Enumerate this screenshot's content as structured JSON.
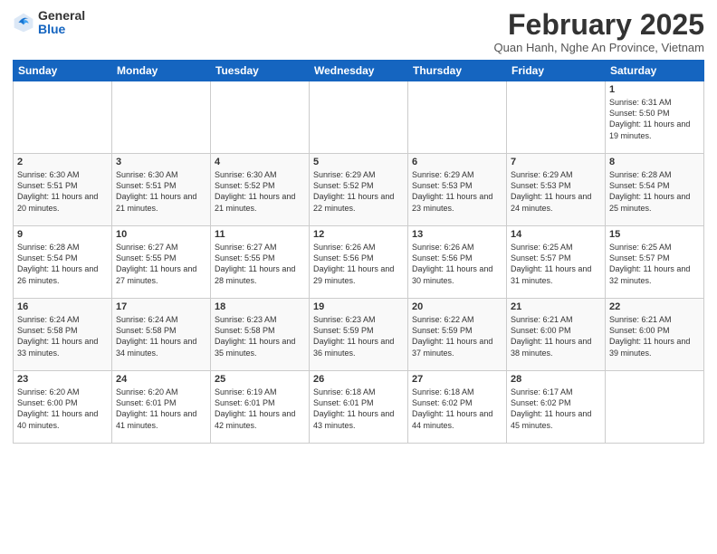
{
  "logo": {
    "general": "General",
    "blue": "Blue"
  },
  "header": {
    "month": "February 2025",
    "location": "Quan Hanh, Nghe An Province, Vietnam"
  },
  "days_of_week": [
    "Sunday",
    "Monday",
    "Tuesday",
    "Wednesday",
    "Thursday",
    "Friday",
    "Saturday"
  ],
  "weeks": [
    [
      {
        "day": "",
        "info": ""
      },
      {
        "day": "",
        "info": ""
      },
      {
        "day": "",
        "info": ""
      },
      {
        "day": "",
        "info": ""
      },
      {
        "day": "",
        "info": ""
      },
      {
        "day": "",
        "info": ""
      },
      {
        "day": "1",
        "info": "Sunrise: 6:31 AM\nSunset: 5:50 PM\nDaylight: 11 hours and 19 minutes."
      }
    ],
    [
      {
        "day": "2",
        "info": "Sunrise: 6:30 AM\nSunset: 5:51 PM\nDaylight: 11 hours and 20 minutes."
      },
      {
        "day": "3",
        "info": "Sunrise: 6:30 AM\nSunset: 5:51 PM\nDaylight: 11 hours and 21 minutes."
      },
      {
        "day": "4",
        "info": "Sunrise: 6:30 AM\nSunset: 5:52 PM\nDaylight: 11 hours and 21 minutes."
      },
      {
        "day": "5",
        "info": "Sunrise: 6:29 AM\nSunset: 5:52 PM\nDaylight: 11 hours and 22 minutes."
      },
      {
        "day": "6",
        "info": "Sunrise: 6:29 AM\nSunset: 5:53 PM\nDaylight: 11 hours and 23 minutes."
      },
      {
        "day": "7",
        "info": "Sunrise: 6:29 AM\nSunset: 5:53 PM\nDaylight: 11 hours and 24 minutes."
      },
      {
        "day": "8",
        "info": "Sunrise: 6:28 AM\nSunset: 5:54 PM\nDaylight: 11 hours and 25 minutes."
      }
    ],
    [
      {
        "day": "9",
        "info": "Sunrise: 6:28 AM\nSunset: 5:54 PM\nDaylight: 11 hours and 26 minutes."
      },
      {
        "day": "10",
        "info": "Sunrise: 6:27 AM\nSunset: 5:55 PM\nDaylight: 11 hours and 27 minutes."
      },
      {
        "day": "11",
        "info": "Sunrise: 6:27 AM\nSunset: 5:55 PM\nDaylight: 11 hours and 28 minutes."
      },
      {
        "day": "12",
        "info": "Sunrise: 6:26 AM\nSunset: 5:56 PM\nDaylight: 11 hours and 29 minutes."
      },
      {
        "day": "13",
        "info": "Sunrise: 6:26 AM\nSunset: 5:56 PM\nDaylight: 11 hours and 30 minutes."
      },
      {
        "day": "14",
        "info": "Sunrise: 6:25 AM\nSunset: 5:57 PM\nDaylight: 11 hours and 31 minutes."
      },
      {
        "day": "15",
        "info": "Sunrise: 6:25 AM\nSunset: 5:57 PM\nDaylight: 11 hours and 32 minutes."
      }
    ],
    [
      {
        "day": "16",
        "info": "Sunrise: 6:24 AM\nSunset: 5:58 PM\nDaylight: 11 hours and 33 minutes."
      },
      {
        "day": "17",
        "info": "Sunrise: 6:24 AM\nSunset: 5:58 PM\nDaylight: 11 hours and 34 minutes."
      },
      {
        "day": "18",
        "info": "Sunrise: 6:23 AM\nSunset: 5:58 PM\nDaylight: 11 hours and 35 minutes."
      },
      {
        "day": "19",
        "info": "Sunrise: 6:23 AM\nSunset: 5:59 PM\nDaylight: 11 hours and 36 minutes."
      },
      {
        "day": "20",
        "info": "Sunrise: 6:22 AM\nSunset: 5:59 PM\nDaylight: 11 hours and 37 minutes."
      },
      {
        "day": "21",
        "info": "Sunrise: 6:21 AM\nSunset: 6:00 PM\nDaylight: 11 hours and 38 minutes."
      },
      {
        "day": "22",
        "info": "Sunrise: 6:21 AM\nSunset: 6:00 PM\nDaylight: 11 hours and 39 minutes."
      }
    ],
    [
      {
        "day": "23",
        "info": "Sunrise: 6:20 AM\nSunset: 6:00 PM\nDaylight: 11 hours and 40 minutes."
      },
      {
        "day": "24",
        "info": "Sunrise: 6:20 AM\nSunset: 6:01 PM\nDaylight: 11 hours and 41 minutes."
      },
      {
        "day": "25",
        "info": "Sunrise: 6:19 AM\nSunset: 6:01 PM\nDaylight: 11 hours and 42 minutes."
      },
      {
        "day": "26",
        "info": "Sunrise: 6:18 AM\nSunset: 6:01 PM\nDaylight: 11 hours and 43 minutes."
      },
      {
        "day": "27",
        "info": "Sunrise: 6:18 AM\nSunset: 6:02 PM\nDaylight: 11 hours and 44 minutes."
      },
      {
        "day": "28",
        "info": "Sunrise: 6:17 AM\nSunset: 6:02 PM\nDaylight: 11 hours and 45 minutes."
      },
      {
        "day": "",
        "info": ""
      }
    ]
  ]
}
